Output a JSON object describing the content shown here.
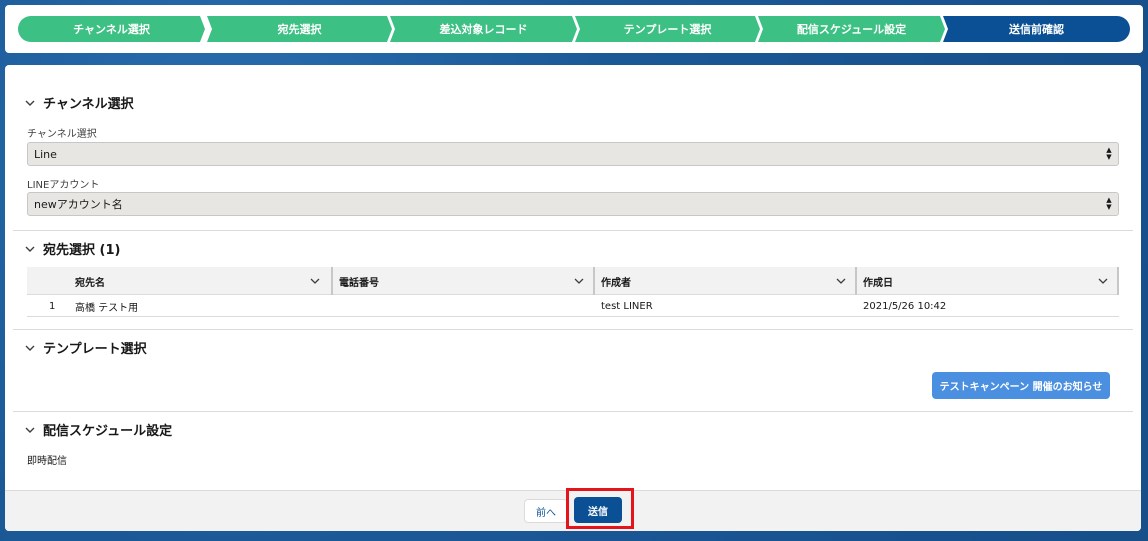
{
  "progress": {
    "steps": [
      {
        "label": "チャンネル選択",
        "state": "done"
      },
      {
        "label": "宛先選択",
        "state": "done"
      },
      {
        "label": "差込対象レコード",
        "state": "done"
      },
      {
        "label": "テンプレート選択",
        "state": "done"
      },
      {
        "label": "配信スケジュール設定",
        "state": "done"
      },
      {
        "label": "送信前確認",
        "state": "current"
      }
    ],
    "colors": {
      "done": "#3cc083",
      "current": "#0b4f94"
    }
  },
  "channel_section": {
    "title": "チャンネル選択",
    "channel_label": "チャンネル選択",
    "channel_value": "Line",
    "account_label": "LINEアカウント",
    "account_value": "newアカウント名"
  },
  "recipient_section": {
    "title": "宛先選択 (1)",
    "columns": [
      "宛先名",
      "電話番号",
      "作成者",
      "作成日"
    ],
    "rows": [
      {
        "index": "1",
        "name": "高橋 テスト用",
        "phone": "",
        "created_by": "test LINER",
        "created_date": "2021/5/26 10:42"
      }
    ]
  },
  "template_section": {
    "title": "テンプレート選択",
    "template_button": "テストキャンペーン 開催のお知らせ"
  },
  "schedule_section": {
    "title": "配信スケジュール設定",
    "value": "即時配信"
  },
  "footer": {
    "prev_label": "前へ",
    "send_label": "送信",
    "highlight_color": "#e4141a"
  }
}
